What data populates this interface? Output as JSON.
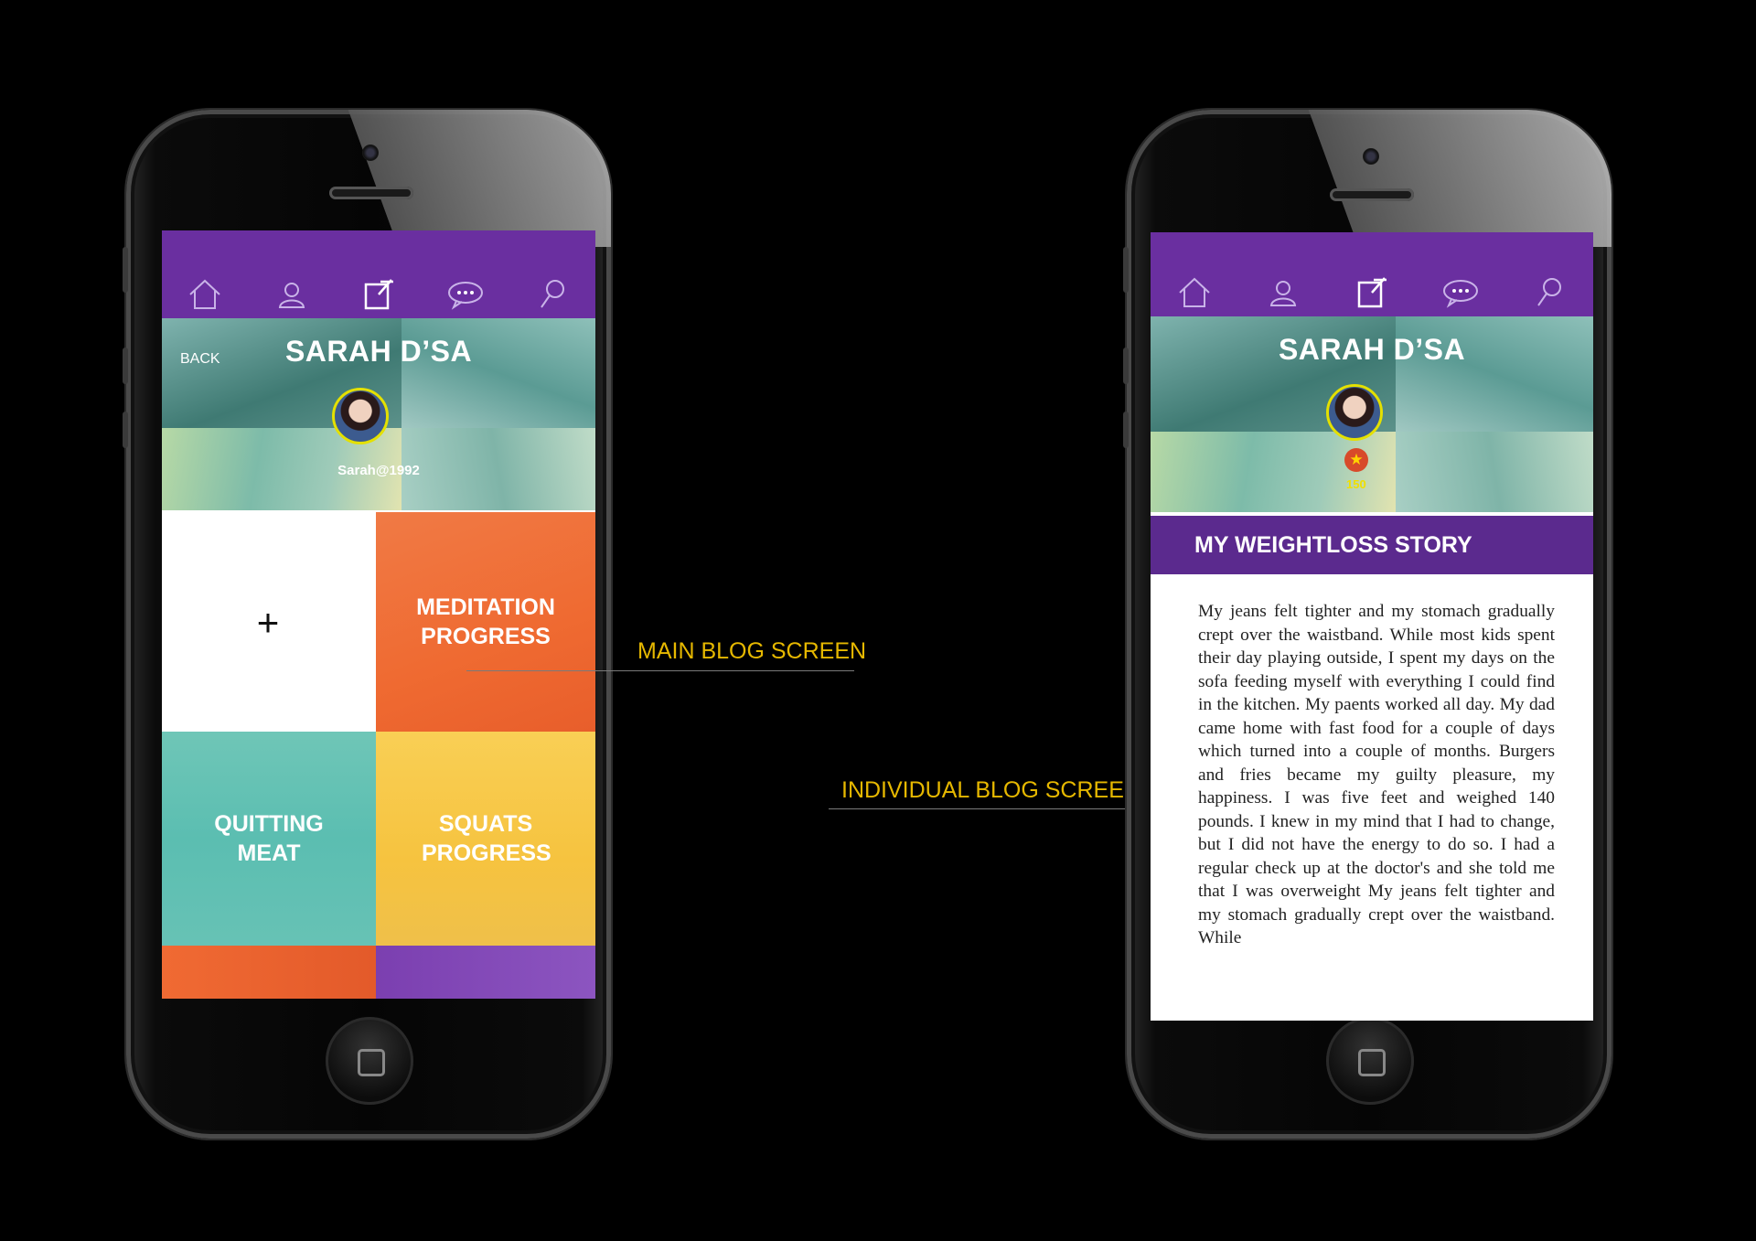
{
  "annotations": {
    "main": "MAIN BLOG SCREEN",
    "individual": "INDIVIDUAL BLOG SCREEN"
  },
  "nav_icons": [
    "home-icon",
    "user-icon",
    "edit-icon",
    "chat-icon",
    "search-icon"
  ],
  "main_screen": {
    "back_label": "BACK",
    "profile_name": "SARAH D’SA",
    "handle": "Sarah@1992",
    "add_symbol": "+",
    "tiles": [
      {
        "label": "MEDITATION PROGRESS",
        "color": "#f06a33"
      },
      {
        "label": "QUITTING MEAT",
        "color": "#62c2b4"
      },
      {
        "label": "SQUATS PROGRESS",
        "color": "#f7c646"
      }
    ],
    "colors": {
      "purple": "#6a2fa0",
      "orange": "#f06a33",
      "teal": "#62c2b4",
      "yellow": "#f7c646"
    }
  },
  "blog_screen": {
    "profile_name": "SARAH D’SA",
    "points": "150",
    "story_title": "MY WEIGHTLOSS STORY",
    "story_text": "My jeans felt tighter and my stomach gradually crept over the waistband. While most kids spent their day playing outside, I spent my days on the sofa feeding myself with everything I could find in the kitchen. My paents worked all day. My dad came home with fast food for a couple of days which turned into a couple of months. Burgers and fries became my guilty pleasure, my happiness. I was five feet and weighed 140 pounds. I knew in my mind that I had to change, but I did not have the energy to do so. I had a regular check up at the doctor's and she told me that I was overweight My jeans felt tighter and my stomach gradually crept over the waistband. While"
  }
}
